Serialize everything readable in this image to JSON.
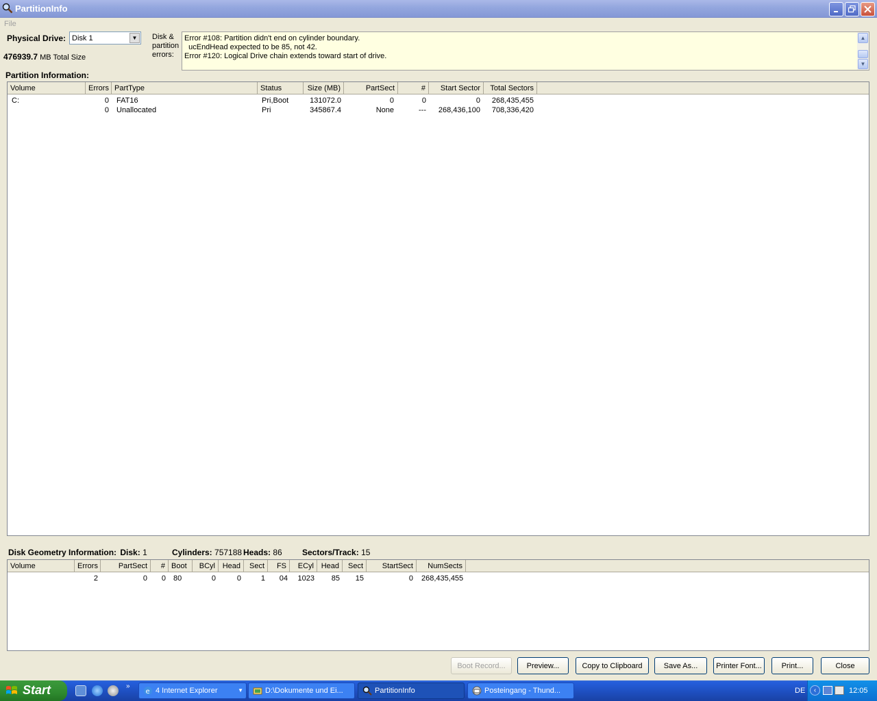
{
  "window": {
    "title": "PartitionInfo"
  },
  "menu": {
    "file": "File"
  },
  "drive": {
    "label": "Physical Drive:",
    "selected": "Disk 1",
    "total_value": "476939.7",
    "total_suffix": "MB Total Size"
  },
  "errors": {
    "label_line1": "Disk &",
    "label_line2": "partition",
    "label_line3": "errors:",
    "lines": [
      "Error #108: Partition didn't end on cylinder boundary.",
      "  ucEndHead expected to be 85, not 42.",
      "Error #120: Logical Drive chain extends toward start of drive."
    ]
  },
  "partition_info": {
    "heading": "Partition Information:",
    "columns": [
      "Volume",
      "Errors",
      "PartType",
      "Status",
      "Size (MB)",
      "PartSect",
      "#",
      "Start Sector",
      "Total Sectors"
    ],
    "rows": [
      [
        "C:",
        "0",
        "FAT16",
        "Pri,Boot",
        "131072.0",
        "0",
        "0",
        "0",
        "268,435,455"
      ],
      [
        "",
        "0",
        "Unallocated",
        "Pri",
        "345867.4",
        "None",
        "---",
        "268,436,100",
        "708,336,420"
      ]
    ]
  },
  "geometry": {
    "heading": "Disk Geometry Information:",
    "disk_label": "Disk:",
    "disk_value": "1",
    "cyl_label": "Cylinders:",
    "cyl_value": "757188",
    "heads_label": "Heads:",
    "heads_value": "86",
    "spt_label": "Sectors/Track:",
    "spt_value": "15",
    "columns": [
      "Volume",
      "Errors",
      "PartSect",
      "#",
      "Boot",
      "BCyl",
      "Head",
      "Sect",
      "FS",
      "ECyl",
      "Head",
      "Sect",
      "StartSect",
      "NumSects"
    ],
    "rows": [
      [
        "",
        "2",
        "0",
        "0",
        "80",
        "0",
        "0",
        "1",
        "04",
        "1023",
        "85",
        "15",
        "0",
        "268,435,455"
      ]
    ]
  },
  "buttons": {
    "boot_record": "Boot Record...",
    "preview": "Preview...",
    "copy": "Copy to Clipboard",
    "save_as": "Save As...",
    "printer_font": "Printer Font...",
    "print": "Print...",
    "close": "Close"
  },
  "taskbar": {
    "start": "Start",
    "tasks": [
      "4 Internet Explorer",
      "D:\\Dokumente und Ei...",
      "PartitionInfo",
      "Posteingang - Thund..."
    ],
    "lang": "DE",
    "clock": "12:05"
  },
  "colors": {
    "error_bg": "#ffffe1",
    "taskbar": "#245edb",
    "start": "#2f8a2f"
  }
}
